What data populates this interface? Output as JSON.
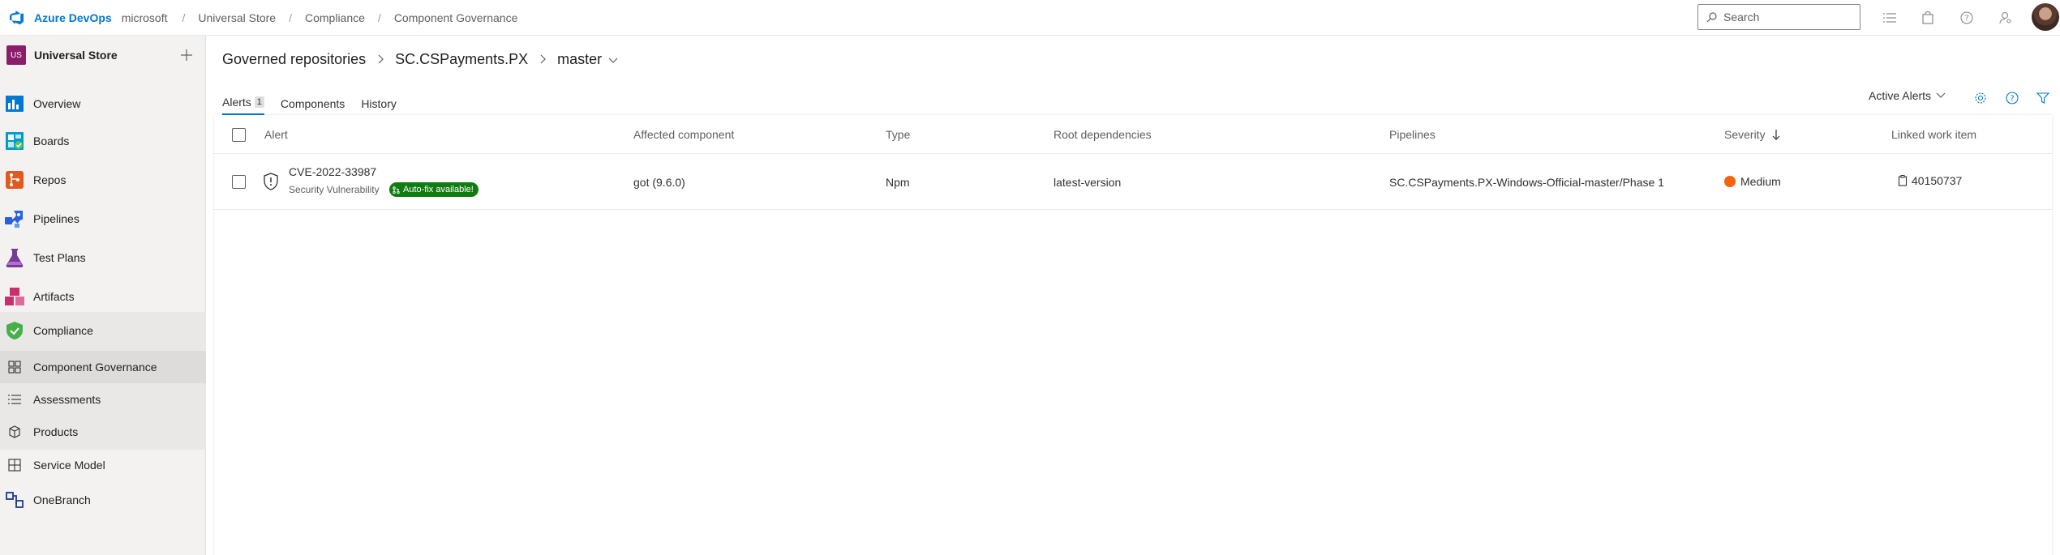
{
  "topbar": {
    "brand": "Azure DevOps",
    "org": "microsoft",
    "breadcrumbs": [
      "Universal Store",
      "Compliance",
      "Component Governance"
    ],
    "search_placeholder": "Search"
  },
  "sidebar": {
    "project_initials": "US",
    "project_name": "Universal Store",
    "items": [
      {
        "label": "Overview",
        "icon": "overview-icon",
        "color": "#0078d4"
      },
      {
        "label": "Boards",
        "icon": "boards-icon",
        "color": "#009ccc"
      },
      {
        "label": "Repos",
        "icon": "repos-icon",
        "color": "#e05a1f"
      },
      {
        "label": "Pipelines",
        "icon": "pipelines-icon",
        "color": "#2560e0"
      },
      {
        "label": "Test Plans",
        "icon": "test-plans-icon",
        "color": "#773b93"
      },
      {
        "label": "Artifacts",
        "icon": "artifacts-icon",
        "color": "#cb2e6d"
      },
      {
        "label": "Compliance",
        "icon": "compliance-shield-icon",
        "color": "#46b048"
      }
    ],
    "sub_items": [
      {
        "label": "Component Governance",
        "icon": "component-governance-icon"
      },
      {
        "label": "Assessments",
        "icon": "assessments-list-icon"
      },
      {
        "label": "Products",
        "icon": "products-box-icon"
      },
      {
        "label": "Service Model",
        "icon": "service-model-grid-icon"
      }
    ],
    "onebranch": {
      "label": "OneBranch",
      "icon": "onebranch-icon",
      "color": "#1e3a8a"
    }
  },
  "main": {
    "breadcrumbs": [
      "Governed repositories",
      "SC.CSPayments.PX",
      "master"
    ],
    "tabs": [
      {
        "label": "Alerts",
        "count": "1"
      },
      {
        "label": "Components"
      },
      {
        "label": "History"
      }
    ],
    "filter_label": "Active Alerts",
    "table": {
      "columns": [
        "Alert",
        "Affected component",
        "Type",
        "Root dependencies",
        "Pipelines",
        "Severity",
        "Linked work item"
      ],
      "rows": [
        {
          "alert_id": "CVE-2022-33987",
          "alert_type": "Security Vulnerability",
          "badge": "Auto-fix available!",
          "component": "got (9.6.0)",
          "type": "Npm",
          "root_dependency": "latest-version",
          "pipeline": "SC.CSPayments.PX-Windows-Official-master/Phase 1",
          "severity": "Medium",
          "severity_color": "#f7630c",
          "work_item": "40150737"
        }
      ]
    }
  }
}
